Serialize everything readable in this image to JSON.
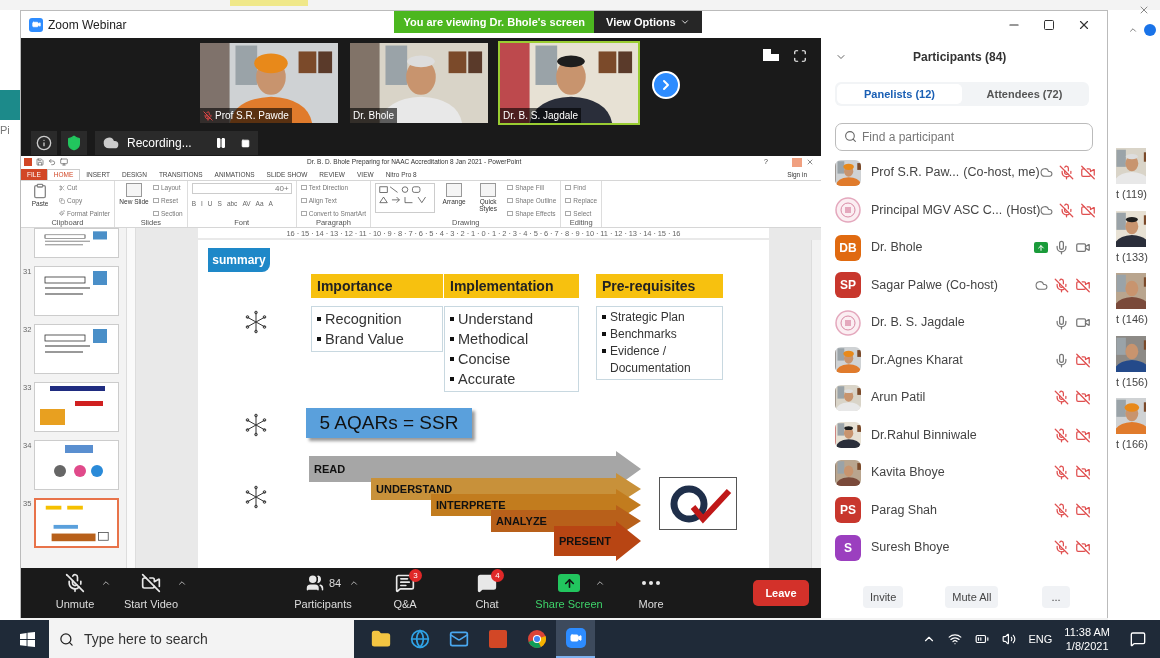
{
  "background": {
    "left_fragment": "Pi",
    "right_counts": [
      "t (119)",
      "t (133)",
      "t (146)",
      "t (156)",
      "t (166)"
    ]
  },
  "window": {
    "title": "Zoom Webinar",
    "banner": "You are viewing Dr. Bhole's screen",
    "view_options": "View Options"
  },
  "videos": [
    {
      "name": "Prof S.R. Pawde",
      "muted": true,
      "active": false
    },
    {
      "name": "Dr. Bhole",
      "muted": false,
      "active": false
    },
    {
      "name": "Dr. B. S. Jagdale",
      "muted": false,
      "active": true
    }
  ],
  "recording": {
    "label": "Recording..."
  },
  "powerpoint": {
    "title": "Dr. B. D. Bhole Preparing for NAAC Accreditation 8 Jan 2021 - PowerPoint",
    "help": "?",
    "sign_in": "Sign in",
    "tabs": [
      {
        "label": "FILE",
        "kind": "file",
        "selected": false
      },
      {
        "label": "HOME",
        "kind": "tab",
        "selected": true
      },
      {
        "label": "INSERT",
        "kind": "tab",
        "selected": false
      },
      {
        "label": "DESIGN",
        "kind": "tab",
        "selected": false
      },
      {
        "label": "TRANSITIONS",
        "kind": "tab",
        "selected": false
      },
      {
        "label": "ANIMATIONS",
        "kind": "tab",
        "selected": false
      },
      {
        "label": "SLIDE SHOW",
        "kind": "tab",
        "selected": false
      },
      {
        "label": "REVIEW",
        "kind": "tab",
        "selected": false
      },
      {
        "label": "VIEW",
        "kind": "tab",
        "selected": false
      },
      {
        "label": "Nitro Pro 8",
        "kind": "tab",
        "selected": false
      }
    ],
    "ribbon": [
      {
        "label": "Clipboard",
        "kind": "buttons",
        "large": [
          "Paste"
        ],
        "small": [
          "Cut",
          "Copy",
          "Format Painter"
        ]
      },
      {
        "label": "Slides",
        "kind": "buttons",
        "large": [
          "New Slide"
        ],
        "small": [
          "Layout",
          "Reset",
          "Section"
        ]
      },
      {
        "label": "Font",
        "kind": "font",
        "font_size": "40+",
        "buttons": [
          "B",
          "I",
          "U",
          "S",
          "abc",
          "AV",
          "Aa",
          "A"
        ]
      },
      {
        "label": "Paragraph",
        "kind": "buttons",
        "small": [
          "Text Direction",
          "Align Text",
          "Convert to SmartArt"
        ]
      },
      {
        "label": "Drawing",
        "kind": "shapes",
        "large": [
          "Arrange",
          "Quick Styles"
        ],
        "small": [
          "Shape Fill",
          "Shape Outline",
          "Shape Effects"
        ]
      },
      {
        "label": "Editing",
        "kind": "buttons",
        "small": [
          "Find",
          "Replace",
          "Select"
        ]
      }
    ],
    "ruler": "16 · 15 · 14 · 13 · 12 · 11 · 10 · 9 · 8 · 7 · 6 · 5 · 4 · 3 · 2 · 1 · 0 · 1 · 2 · 3 · 4 · 5 · 6 · 7 · 8 · 9 · 10 · 11 · 12 · 13 · 14 · 15 · 16",
    "thumbnails": [
      {
        "number": "31",
        "selected": false
      },
      {
        "number": "32",
        "selected": false
      },
      {
        "number": "33",
        "selected": false
      },
      {
        "number": "34",
        "selected": false
      },
      {
        "number": "35",
        "selected": true
      }
    ],
    "slide": {
      "tag": "summary",
      "columns": [
        {
          "heading": "Importance",
          "items": [
            "Recognition",
            "Brand Value"
          ]
        },
        {
          "heading": "Implementation",
          "items": [
            "Understand",
            "Methodical",
            "Concise",
            "Accurate"
          ]
        },
        {
          "heading": "Pre-requisites",
          "items": [
            "Strategic Plan",
            "Benchmarks",
            "Evidence / Documentation"
          ]
        }
      ],
      "equation": "5 AQARs = SSR",
      "steps": [
        {
          "label": "READ",
          "color": "#a6a6a6"
        },
        {
          "label": "UNDERSTAND",
          "color": "#c8913a"
        },
        {
          "label": "INTERPRETE",
          "color": "#c27c1e"
        },
        {
          "label": "ANALYZE",
          "color": "#b8601a"
        },
        {
          "label": "PRESENT",
          "color": "#b84513"
        }
      ]
    }
  },
  "toolbar": {
    "items": [
      {
        "kind": "mic",
        "label": "Unmute",
        "caret": true
      },
      {
        "kind": "video",
        "label": "Start Video",
        "caret": true
      },
      {
        "kind": "participants",
        "label": "Participants",
        "count": "84",
        "caret": true
      },
      {
        "kind": "qa",
        "label": "Q&A",
        "badge": "3",
        "caret": false
      },
      {
        "kind": "chat",
        "label": "Chat",
        "badge": "4",
        "caret": false
      },
      {
        "kind": "share",
        "label": "Share Screen",
        "caret": true
      },
      {
        "kind": "more",
        "label": "More",
        "caret": false
      }
    ],
    "leave": "Leave"
  },
  "participants": {
    "title": "Participants (84)",
    "tabs": [
      {
        "label": "Panelists (12)",
        "selected": true
      },
      {
        "label": "Attendees (72)",
        "selected": false
      }
    ],
    "search": {
      "placeholder": "Find a participant"
    },
    "rows": [
      {
        "name": "Prof S.R. Paw...",
        "role": "(Co-host, me)",
        "cloud": true,
        "sharing": false,
        "mic_muted": true,
        "video_on": false
      },
      {
        "name": "Principal MGV ASC C...",
        "role": "(Host)",
        "kind": "emblem",
        "cloud": true,
        "sharing": false,
        "mic_muted": true,
        "video_on": false
      },
      {
        "name": "Dr. Bhole",
        "kind": "initials",
        "initials": "DB",
        "color": "#e06a10",
        "cloud": false,
        "sharing": true,
        "mic_muted": false,
        "video_on": true
      },
      {
        "name": "Sagar Palwe",
        "role": "(Co-host)",
        "kind": "initials",
        "initials": "SP",
        "color": "#c8372d",
        "cloud": true,
        "sharing": false,
        "mic_muted": true,
        "video_on": false
      },
      {
        "name": "Dr. B. S. Jagdale",
        "kind": "emblem",
        "cloud": false,
        "sharing": false,
        "mic_muted": false,
        "video_on": true
      },
      {
        "name": "Dr.Agnes Kharat",
        "cloud": false,
        "sharing": false,
        "mic_muted": false,
        "video_on": false
      },
      {
        "name": "Arun Patil",
        "cloud": false,
        "sharing": false,
        "mic_muted": true,
        "video_on": false
      },
      {
        "name": "Dr.Rahul Binniwale",
        "cloud": false,
        "sharing": false,
        "mic_muted": true,
        "video_on": false
      },
      {
        "name": "Kavita Bhoye",
        "cloud": false,
        "sharing": false,
        "mic_muted": true,
        "video_on": false
      },
      {
        "name": "Parag Shah",
        "kind": "initials",
        "initials": "PS",
        "color": "#c8372d",
        "cloud": false,
        "sharing": false,
        "mic_muted": true,
        "video_on": false
      },
      {
        "name": "Suresh Bhoye",
        "kind": "initials",
        "initials": "S",
        "color": "#9b3fbf",
        "cloud": false,
        "sharing": false,
        "mic_muted": true,
        "video_on": false
      }
    ],
    "buttons": [
      "Invite",
      "Mute All",
      "..."
    ]
  },
  "taskbar": {
    "search_placeholder": "Type here to search",
    "apps": [
      {
        "kind": "explorer",
        "active": false
      },
      {
        "kind": "edge",
        "active": false
      },
      {
        "kind": "mail",
        "active": false
      },
      {
        "kind": "powerpoint",
        "active": false
      },
      {
        "kind": "chrome",
        "active": false
      },
      {
        "kind": "zoom",
        "active": true
      }
    ],
    "language": "ENG",
    "time": "11:38 AM",
    "date": "1/8/2021"
  }
}
